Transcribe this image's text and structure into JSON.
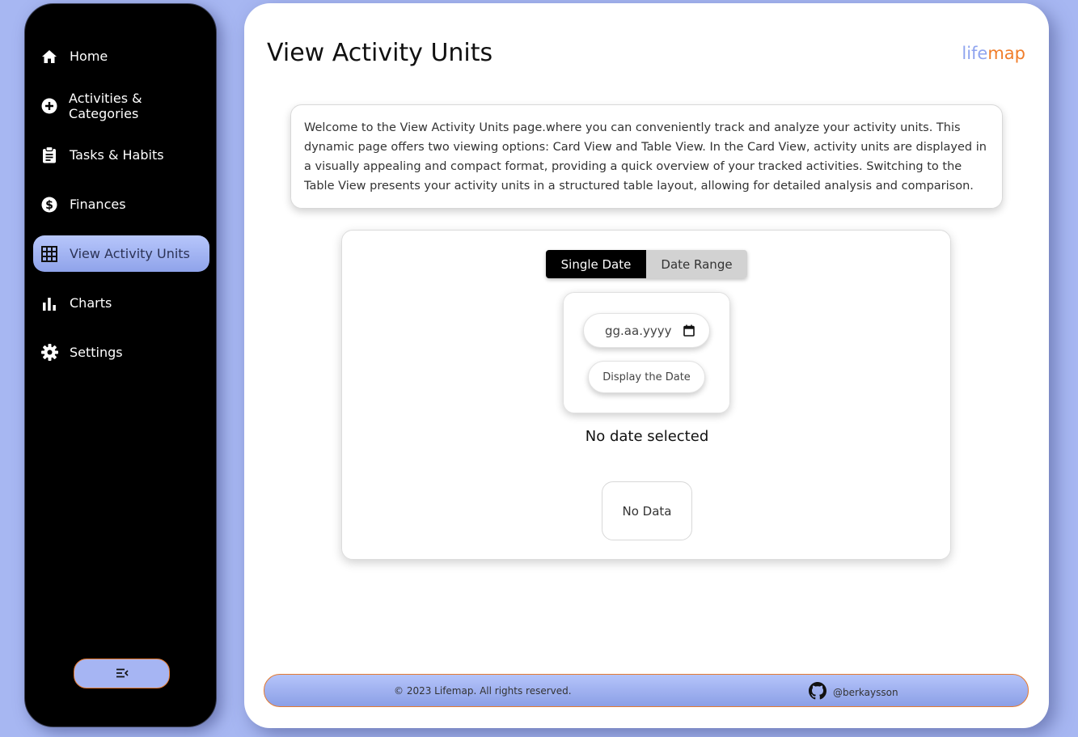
{
  "sidebar": {
    "items": [
      {
        "label": "Home",
        "icon": "home-icon"
      },
      {
        "label": "Activities & Categories",
        "icon": "plus-circle-icon"
      },
      {
        "label": "Tasks & Habits",
        "icon": "clipboard-icon"
      },
      {
        "label": "Finances",
        "icon": "dollar-circle-icon"
      },
      {
        "label": "View Activity Units",
        "icon": "grid-icon",
        "active": true
      },
      {
        "label": "Charts",
        "icon": "bar-chart-icon"
      },
      {
        "label": "Settings",
        "icon": "gear-icon"
      }
    ],
    "collapse_icon": "collapse-menu-icon"
  },
  "header": {
    "title": "View Activity Units",
    "logo_part1": "life",
    "logo_part2": "map"
  },
  "intro": {
    "text": "Welcome to the View Activity Units page.where you can conveniently track and analyze your activity units. This dynamic page offers two viewing options: Card View and Table View. In the Card View, activity units are displayed in a visually appealing and compact format, providing a quick overview of your tracked activities. Switching to the Table View presents your activity units in a structured table layout, allowing for detailed analysis and comparison."
  },
  "view": {
    "toggle": {
      "selected": "Single Date",
      "other": "Date Range"
    },
    "date_input_placeholder": "gg.aa.yyyy",
    "display_button": "Display the Date",
    "status": "No date selected",
    "empty_state": "No Data"
  },
  "footer": {
    "copyright": "© 2023 Lifemap. All rights reserved.",
    "github_handle": "@berkaysson"
  },
  "colors": {
    "background": "#a7b7f2",
    "accent_orange": "#f07d2a",
    "accent_blue": "#8fa4ef"
  }
}
